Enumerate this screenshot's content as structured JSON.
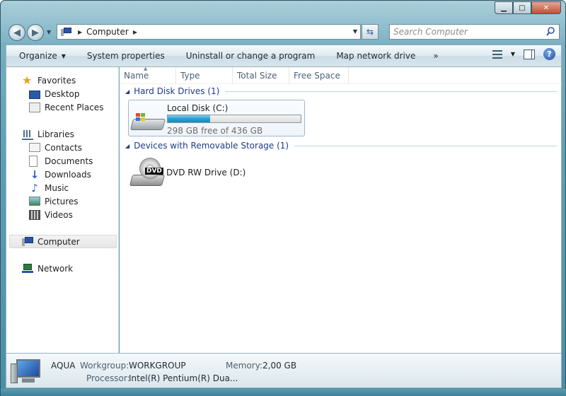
{
  "window": {
    "caption_buttons": {
      "minimize": "▁",
      "maximize": "□",
      "close": "✕"
    }
  },
  "nav": {
    "address_path": "Computer",
    "search_placeholder": "Search Computer"
  },
  "commandbar": {
    "items": [
      "Organize",
      "System properties",
      "Uninstall or change a program",
      "Map network drive"
    ],
    "more": "»"
  },
  "navpane": {
    "favorites": {
      "label": "Favorites",
      "items": [
        "Desktop",
        "Recent Places"
      ]
    },
    "libraries": {
      "label": "Libraries",
      "items": [
        "Contacts",
        "Documents",
        "Downloads",
        "Music",
        "Pictures",
        "Videos"
      ]
    },
    "computer": "Computer",
    "network": "Network"
  },
  "columns": [
    "Name",
    "Type",
    "Total Size",
    "Free Space"
  ],
  "groups": [
    {
      "title": "Hard Disk Drives (1)"
    },
    {
      "title": "Devices with Removable Storage (1)"
    }
  ],
  "drives": {
    "local": {
      "name": "Local Disk (C:)",
      "free_text": "298 GB free of 436 GB",
      "used_fraction": 0.317
    },
    "dvd": {
      "name": "DVD RW Drive (D:)",
      "badge": "DVD"
    }
  },
  "details": {
    "name": "AQUA",
    "workgroup_label": "Workgroup:",
    "workgroup": "WORKGROUP",
    "memory_label": "Memory:",
    "memory": "2,00 GB",
    "processor_label": "Processor:",
    "processor": "Intel(R) Pentium(R) Dua..."
  },
  "colors": {
    "accent": "#1e3b8b",
    "drive_fill": "#26a0d0"
  }
}
